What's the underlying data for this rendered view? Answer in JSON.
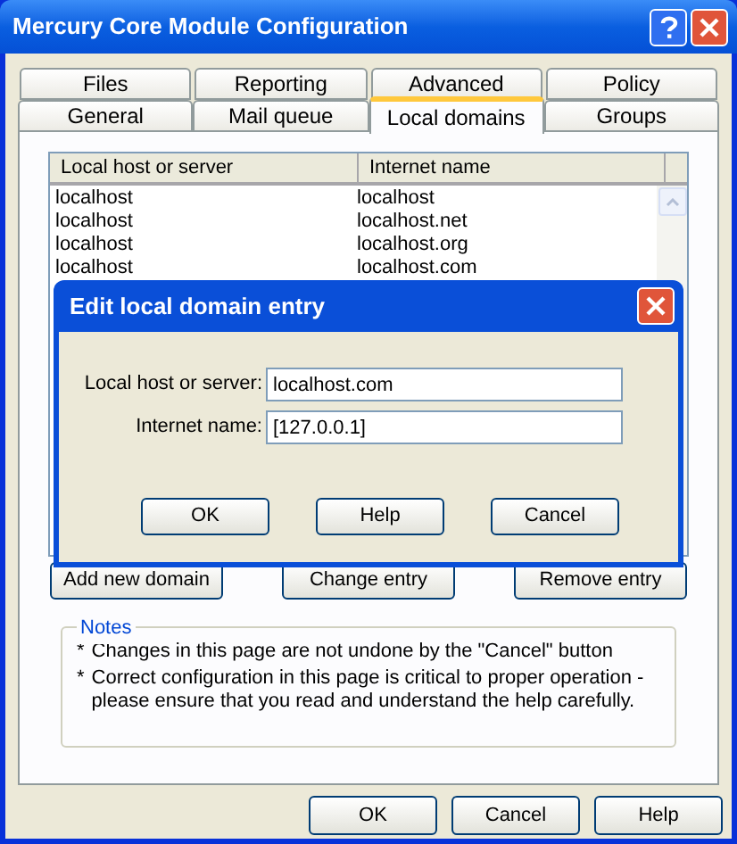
{
  "window": {
    "title": "Mercury Core Module Configuration"
  },
  "tab_rows": [
    [
      {
        "label": "Files",
        "selected": false
      },
      {
        "label": "Reporting",
        "selected": false
      },
      {
        "label": "Advanced",
        "selected": false
      },
      {
        "label": "Policy",
        "selected": false
      }
    ],
    [
      {
        "label": "General",
        "selected": false
      },
      {
        "label": "Mail queue",
        "selected": false
      },
      {
        "label": "Local domains",
        "selected": true
      },
      {
        "label": "Groups",
        "selected": false
      }
    ]
  ],
  "table": {
    "columns": [
      "Local host or server",
      "Internet name"
    ],
    "rows": [
      [
        "localhost",
        "localhost"
      ],
      [
        "localhost",
        "localhost.net"
      ],
      [
        "localhost",
        "localhost.org"
      ],
      [
        "localhost",
        "localhost.com"
      ]
    ]
  },
  "list_buttons": [
    "Add new domain",
    "Change entry",
    "Remove entry"
  ],
  "notes": {
    "title": "Notes",
    "items": [
      {
        "marker": "*",
        "text": "Changes in this page are not undone by the \"Cancel\" button"
      },
      {
        "marker": "*",
        "text": "Correct configuration in this page is critical to proper operation - please ensure that you read and understand the help carefully."
      }
    ]
  },
  "buttons": [
    "OK",
    "Cancel",
    "Help"
  ],
  "dialog": {
    "title": "Edit local domain entry",
    "fields": [
      {
        "label": "Local host or server:",
        "value": "localhost.com"
      },
      {
        "label": "Internet name:",
        "value": "[127.0.0.1]"
      }
    ],
    "buttons": [
      "OK",
      "Help",
      "Cancel"
    ]
  }
}
